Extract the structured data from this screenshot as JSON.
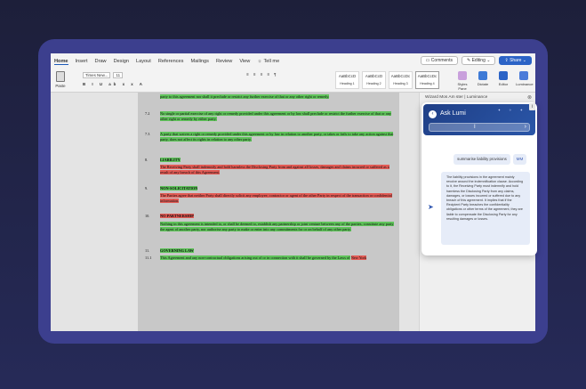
{
  "menu": {
    "tabs": [
      "Home",
      "Insert",
      "Draw",
      "Design",
      "Layout",
      "References",
      "Mailings",
      "Review",
      "View"
    ],
    "tell_me": "Tell me",
    "comments": "Comments",
    "editing": "Editing",
    "share": "Share"
  },
  "ribbon": {
    "paste": "Paste",
    "font_name": "Times New...",
    "font_size": "11",
    "format_row": "B I U ab x x A",
    "para_row": "≡ ≡ ≡ ≡ ¶",
    "styles": [
      {
        "preview": "AaBbCcD",
        "name": "Heading 1"
      },
      {
        "preview": "AaBbCcD",
        "name": "Heading 2"
      },
      {
        "preview": "AaBbCcDc",
        "name": "Heading 3"
      },
      {
        "preview": "AaBbCcDc",
        "name": "Heading 4"
      },
      {
        "preview": "AaBbCcDdEe",
        "name": "Normal"
      },
      {
        "preview": "AaBbCcDdEe",
        "name": "No Spacing"
      }
    ],
    "tools": [
      {
        "label": "Styles Pane",
        "color": "#c9a0dc"
      },
      {
        "label": "Dictate",
        "color": "#3d7ad6"
      },
      {
        "label": "Editor",
        "color": "#2b63c6"
      },
      {
        "label": "Luminance",
        "color": "#4b7bd9"
      }
    ]
  },
  "document": {
    "paragraphs": [
      {
        "num": "",
        "text": "party to this agreement nor shall it preclude or restrict any further exercise of that or any other right or remedy.",
        "hl": "g",
        "heading": false
      },
      {
        "num": "7.2",
        "text": "No single or partial exercise of any right or remedy provided under this agreement or by law shall preclude or restrict the further exercise of that or any other right or remedy by either party.",
        "hl": "g",
        "heading": false
      },
      {
        "num": "7.3",
        "text": "A party that waives a right or remedy provided under this agreement or by law in relation to another party, or takes or fails to take any action against that party, does not affect its rights in relation to any other party.",
        "hl": "g",
        "heading": false
      },
      {
        "num": "8.",
        "text": "LIABILITY",
        "hl": "g",
        "heading": true
      },
      {
        "num": "",
        "text": "The Receiving Party shall indemnify and hold harmless the Disclosing Party from and against all losses, damages and claims incurred or suffered as a result of any breach of this Agreement.",
        "hl": "r",
        "heading": false
      },
      {
        "num": "9.",
        "text": "NON-SOLICITATION",
        "hl": "g",
        "heading": true
      },
      {
        "num": "",
        "text": "The Parties agree that neither Party shall directly solicit any employee, contractor or agent of the other Party in respect of the transaction or confidential information.",
        "hl": "r",
        "heading": false
      },
      {
        "num": "10.",
        "text": "NO PARTNERSHIP",
        "hl": "r",
        "heading": true
      },
      {
        "num": "",
        "text": "Nothing in this agreement is intended to, or shall be deemed to, establish any partnership or joint venture between any of the parties, constitute any party the agent of another party, nor authorise any party to make or enter into any commitments for or on behalf of any other party.",
        "hl": "g",
        "heading": false
      },
      {
        "num": "11.",
        "text": "GOVERNING LAW",
        "hl": "g",
        "heading": true
      },
      {
        "num": "11.1",
        "text": "This Agreement and any non-contractual obligations arising out of or in connection with it shall be governed by the Laws of",
        "hl": "g",
        "heading": false,
        "tail": "New York"
      }
    ]
  },
  "pane": {
    "title": "Wizard Mos Am ster | Luminance",
    "close": "⊗"
  },
  "chat": {
    "title": "Ask Lumi",
    "info": "i",
    "user_message": "summarise liability provisions",
    "user_initials": "MM",
    "bot_reply": "The liability provisions in the agreement mainly revolve around the indemnification clause. According to it, the Receiving Party must indemnify and hold harmless the Disclosing Party from any claims, damages, or losses incurred or suffered due to any breach of this agreement. It implies that if the Recipient Party breaches the confidentiality obligations or other terms of the agreement, they are liable to compensate the Disclosing Party for any resulting damages or losses."
  }
}
